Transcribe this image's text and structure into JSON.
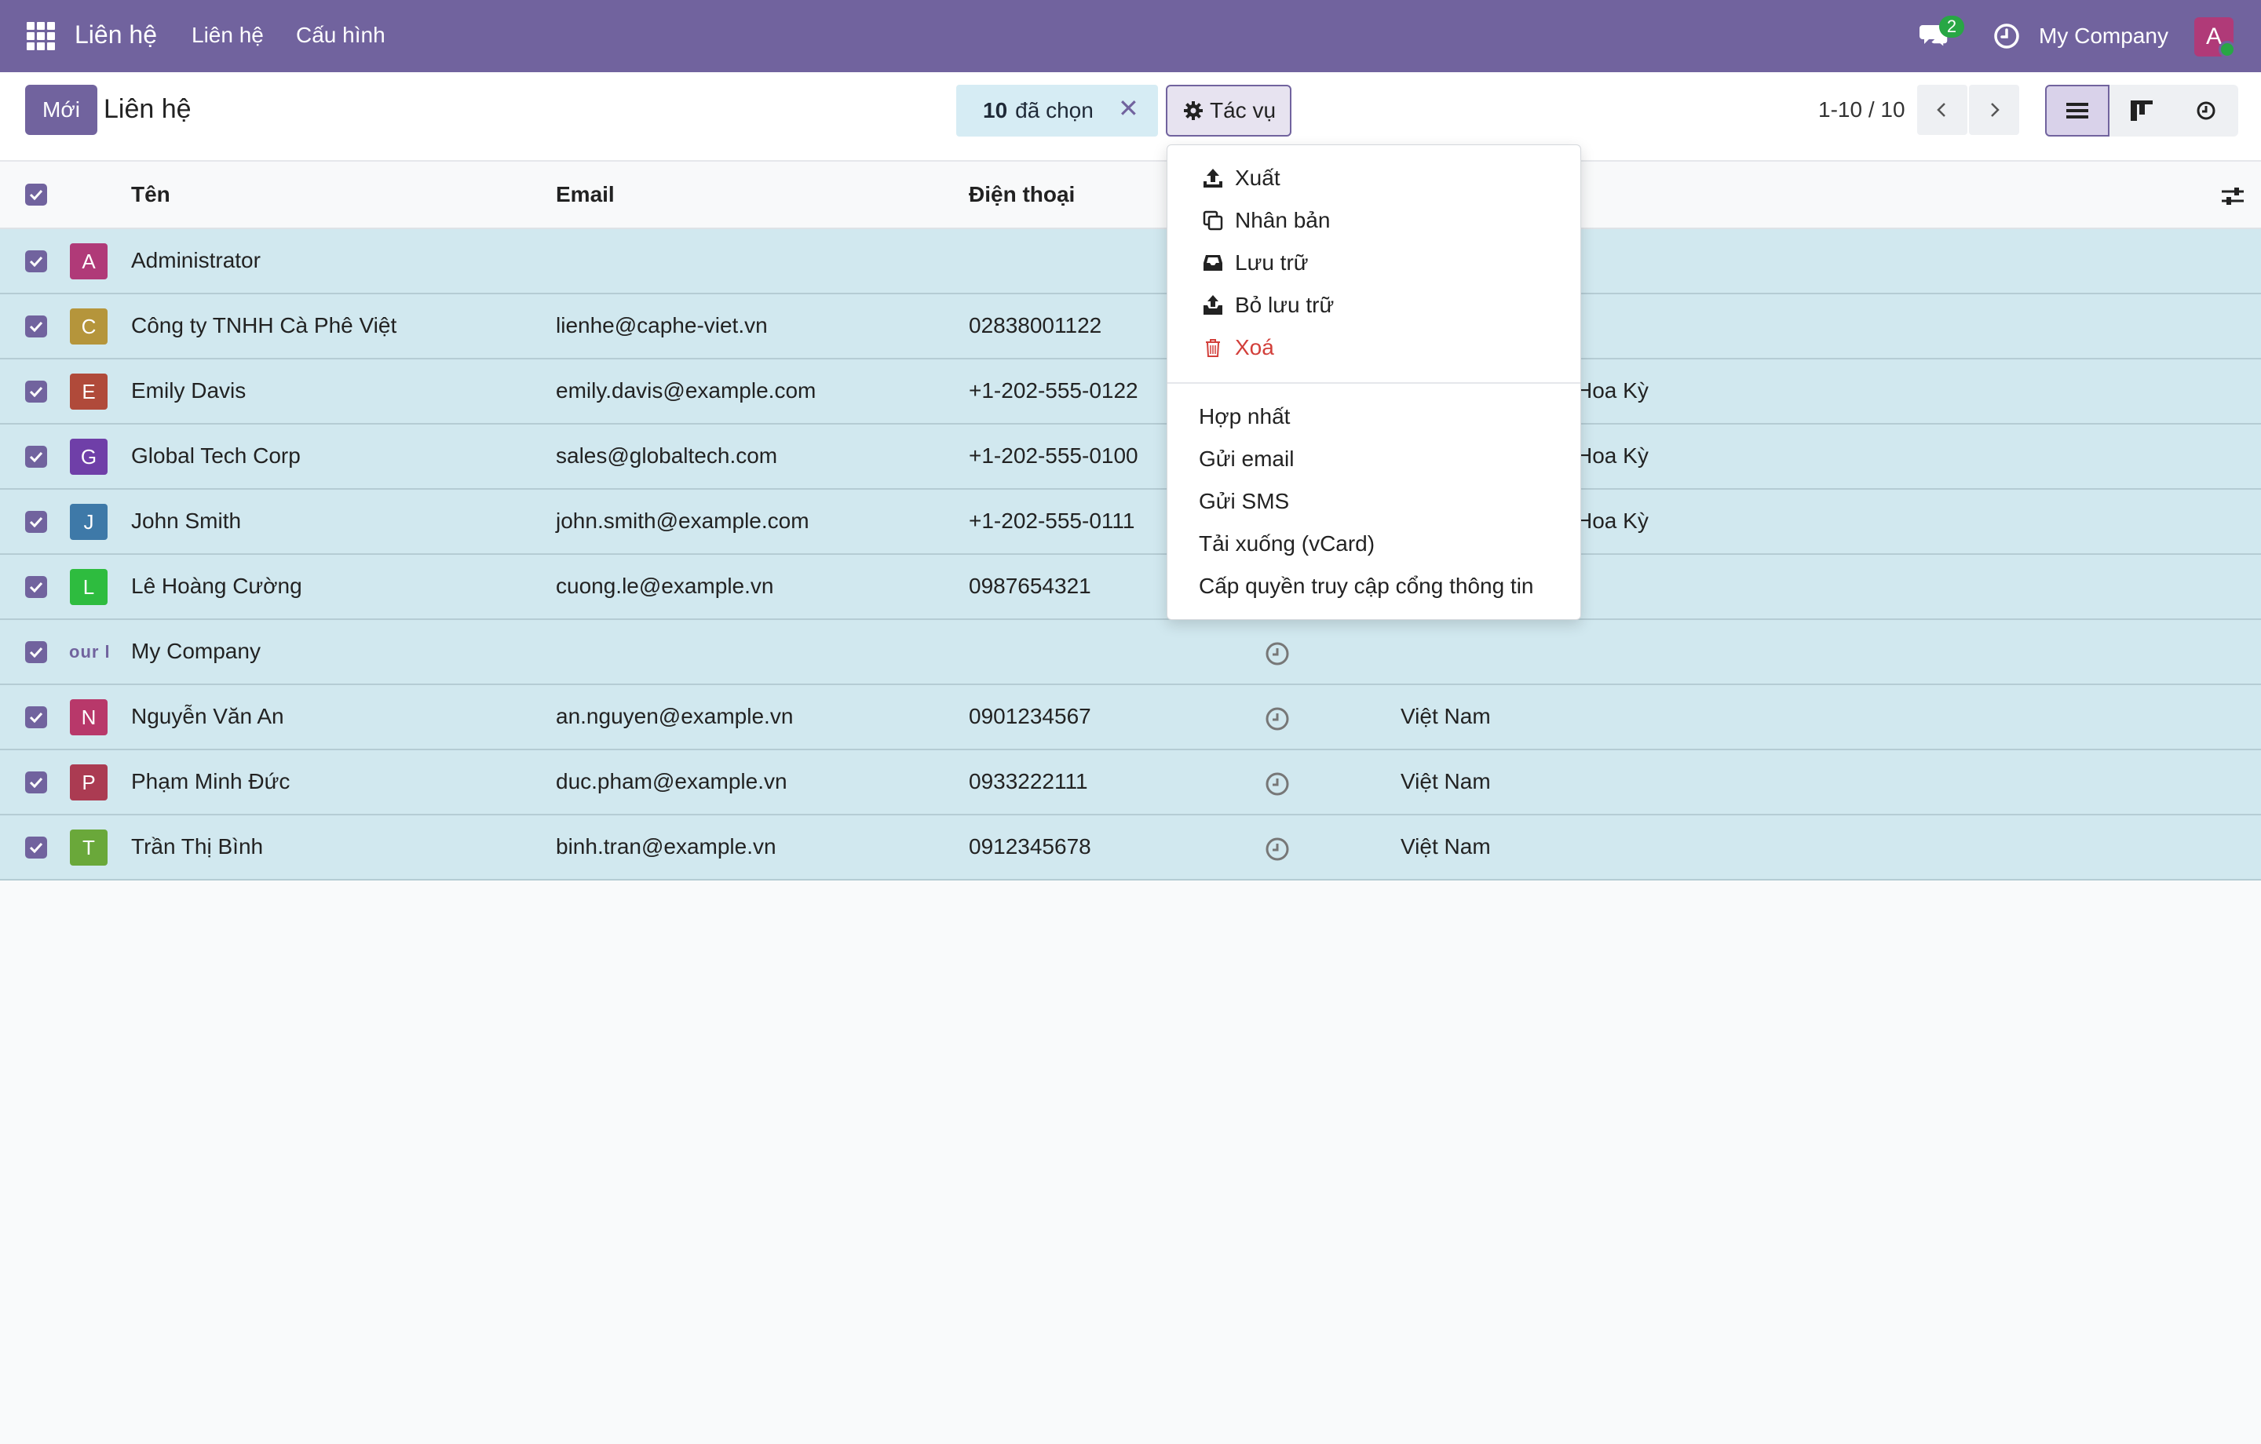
{
  "navbar": {
    "brand": "Liên hệ",
    "menu": [
      "Liên hệ",
      "Cấu hình"
    ],
    "chat_count": "2",
    "company": "My Company",
    "user_initial": "A"
  },
  "control": {
    "new_label": "Mới",
    "title": "Liên hệ",
    "selected_count": "10",
    "selected_label": "đã chọn",
    "actions_label": "Tác vụ",
    "pager": "1-10 / 10"
  },
  "table": {
    "headers": {
      "name": "Tên",
      "email": "Email",
      "phone": "Điện thoại"
    },
    "rows": [
      {
        "initial": "A",
        "color": "#b03a78",
        "name": "Administrator",
        "email": "",
        "phone": "",
        "country": ""
      },
      {
        "initial": "C",
        "color": "#b5953b",
        "name": "Công ty TNHH Cà Phê Việt",
        "email": "lienhe@caphe-viet.vn",
        "phone": "02838001122",
        "country": ""
      },
      {
        "initial": "E",
        "color": "#b04a3a",
        "name": "Emily Davis",
        "email": "emily.davis@example.com",
        "phone": "+1-202-555-0122",
        "country": "Hoa Kỳ"
      },
      {
        "initial": "G",
        "color": "#6f3fa8",
        "name": "Global Tech Corp",
        "email": "sales@globaltech.com",
        "phone": "+1-202-555-0100",
        "country": "Hoa Kỳ"
      },
      {
        "initial": "J",
        "color": "#3e79a8",
        "name": "John Smith",
        "email": "john.smith@example.com",
        "phone": "+1-202-555-0111",
        "country": "Hoa Kỳ"
      },
      {
        "initial": "L",
        "color": "#2ebc3f",
        "name": "Lê Hoàng Cường",
        "email": "cuong.le@example.vn",
        "phone": "0987654321",
        "country": ""
      },
      {
        "initial": "our l",
        "color": "",
        "name": "My Company",
        "email": "",
        "phone": "",
        "country": ""
      },
      {
        "initial": "N",
        "color": "#b8386a",
        "name": "Nguyễn Văn An",
        "email": "an.nguyen@example.vn",
        "phone": "0901234567",
        "country": "Việt Nam"
      },
      {
        "initial": "P",
        "color": "#ab3b52",
        "name": "Phạm Minh Đức",
        "email": "duc.pham@example.vn",
        "phone": "0933222111",
        "country": "Việt Nam"
      },
      {
        "initial": "T",
        "color": "#6aa83a",
        "name": "Trần Thị Bình",
        "email": "binh.tran@example.vn",
        "phone": "0912345678",
        "country": "Việt Nam"
      }
    ]
  },
  "dropdown": {
    "items": [
      {
        "label": "Xuất",
        "icon": "upload-icon"
      },
      {
        "label": "Nhân bản",
        "icon": "copy-icon"
      },
      {
        "label": "Lưu trữ",
        "icon": "archive-icon"
      },
      {
        "label": "Bỏ lưu trữ",
        "icon": "unarchive-icon"
      },
      {
        "label": "Xoá",
        "icon": "trash-icon"
      }
    ],
    "extra": [
      "Hợp nhất",
      "Gửi email",
      "Gửi SMS",
      "Tải xuống (vCard)",
      "Cấp quyền truy cập cổng thông tin"
    ]
  },
  "colors": {
    "brand": "#71639e",
    "selected_row": "#d1e8ef",
    "danger": "#d23f3a"
  }
}
